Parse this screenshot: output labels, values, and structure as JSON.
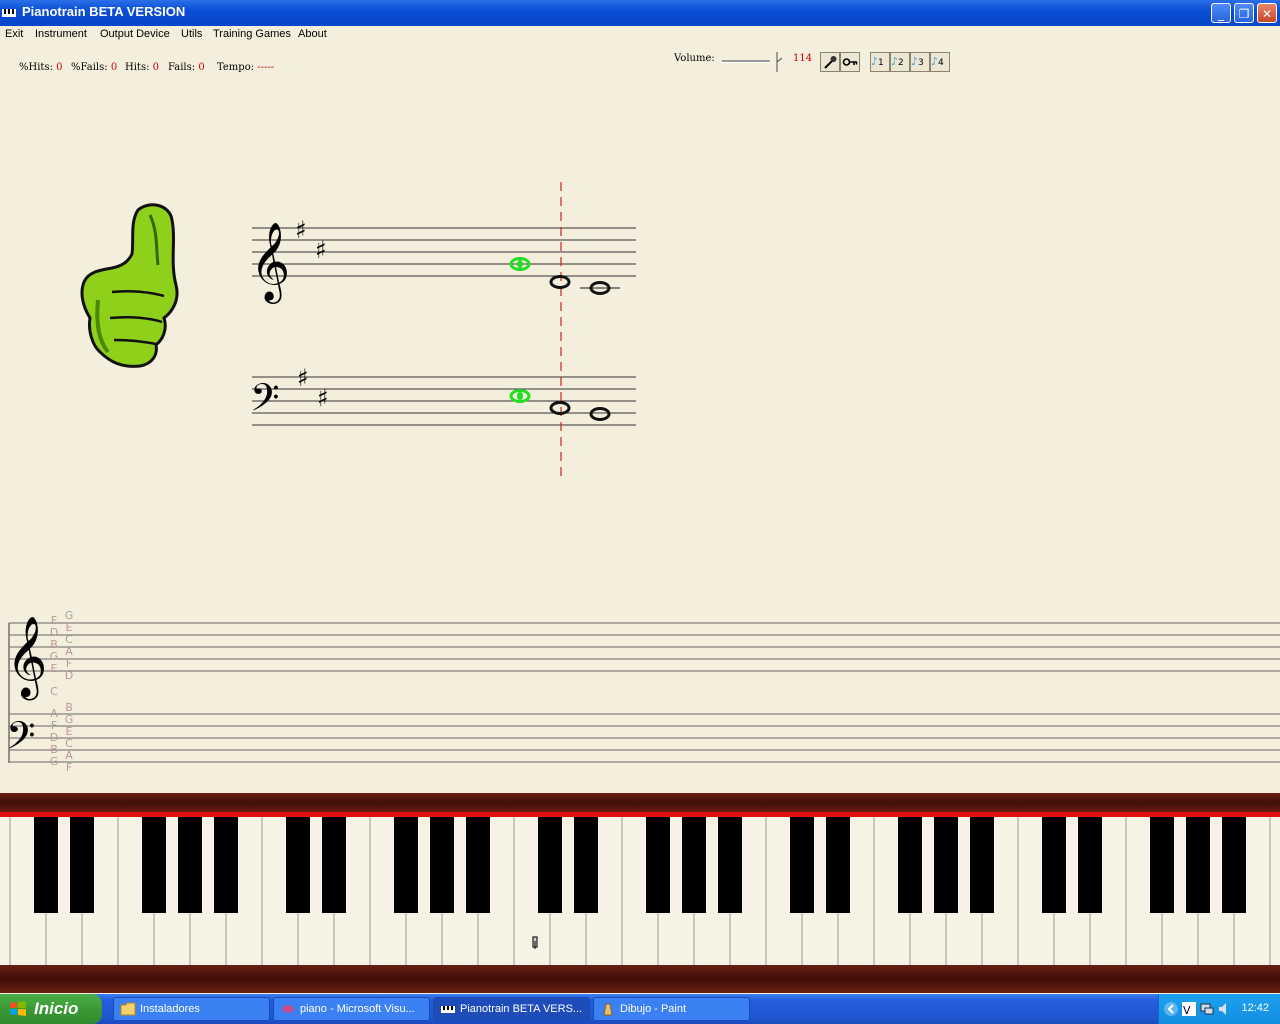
{
  "window": {
    "title": "Pianotrain BETA VERSION",
    "controls": {
      "minimize": "_",
      "maximize": "❐",
      "close": "✕"
    }
  },
  "menu": [
    "Exit",
    "Instrument",
    "Output Device",
    "Utils",
    "Training Games",
    "About"
  ],
  "stats": [
    {
      "label": "%Hits:",
      "value": "0"
    },
    {
      "label": "%Fails:",
      "value": "0"
    },
    {
      "label": "Hits:",
      "value": "0"
    },
    {
      "label": "Fails:",
      "value": "0"
    },
    {
      "label": "Tempo:",
      "value": "-----"
    }
  ],
  "volume": {
    "label": "Volume:",
    "value": "114"
  },
  "toolbar": {
    "mic_icon": "microphone-icon",
    "key_icon": "key-icon"
  },
  "presets": [
    "1",
    "2",
    "3",
    "4"
  ],
  "feedback": {
    "icon": "thumbs-up-icon",
    "color": "#8fd11a"
  },
  "reference_labels": {
    "treble_col1": [
      "F",
      "D",
      "B",
      "G",
      "E",
      "",
      "C"
    ],
    "treble_col2": [
      "G",
      "E",
      "C",
      "A",
      "F",
      "D"
    ],
    "bass_col1": [
      "A",
      "F",
      "D",
      "B",
      "G"
    ],
    "bass_col2": [
      "B",
      "G",
      "E",
      "C",
      "A",
      "F"
    ]
  },
  "colors": {
    "accent_note": "#22dd22",
    "marker_line": "#cc2222",
    "piano_rail": "#e01010",
    "stat_value": "#cc0000"
  },
  "taskbar": {
    "start_label": "Inicio",
    "tasks": [
      "Instaladores",
      "piano - Microsoft Visu...",
      "Pianotrain BETA VERS...",
      "Dibujo - Paint"
    ],
    "active_task": "Pianotrain BETA VERS...",
    "clock": "12:42"
  }
}
